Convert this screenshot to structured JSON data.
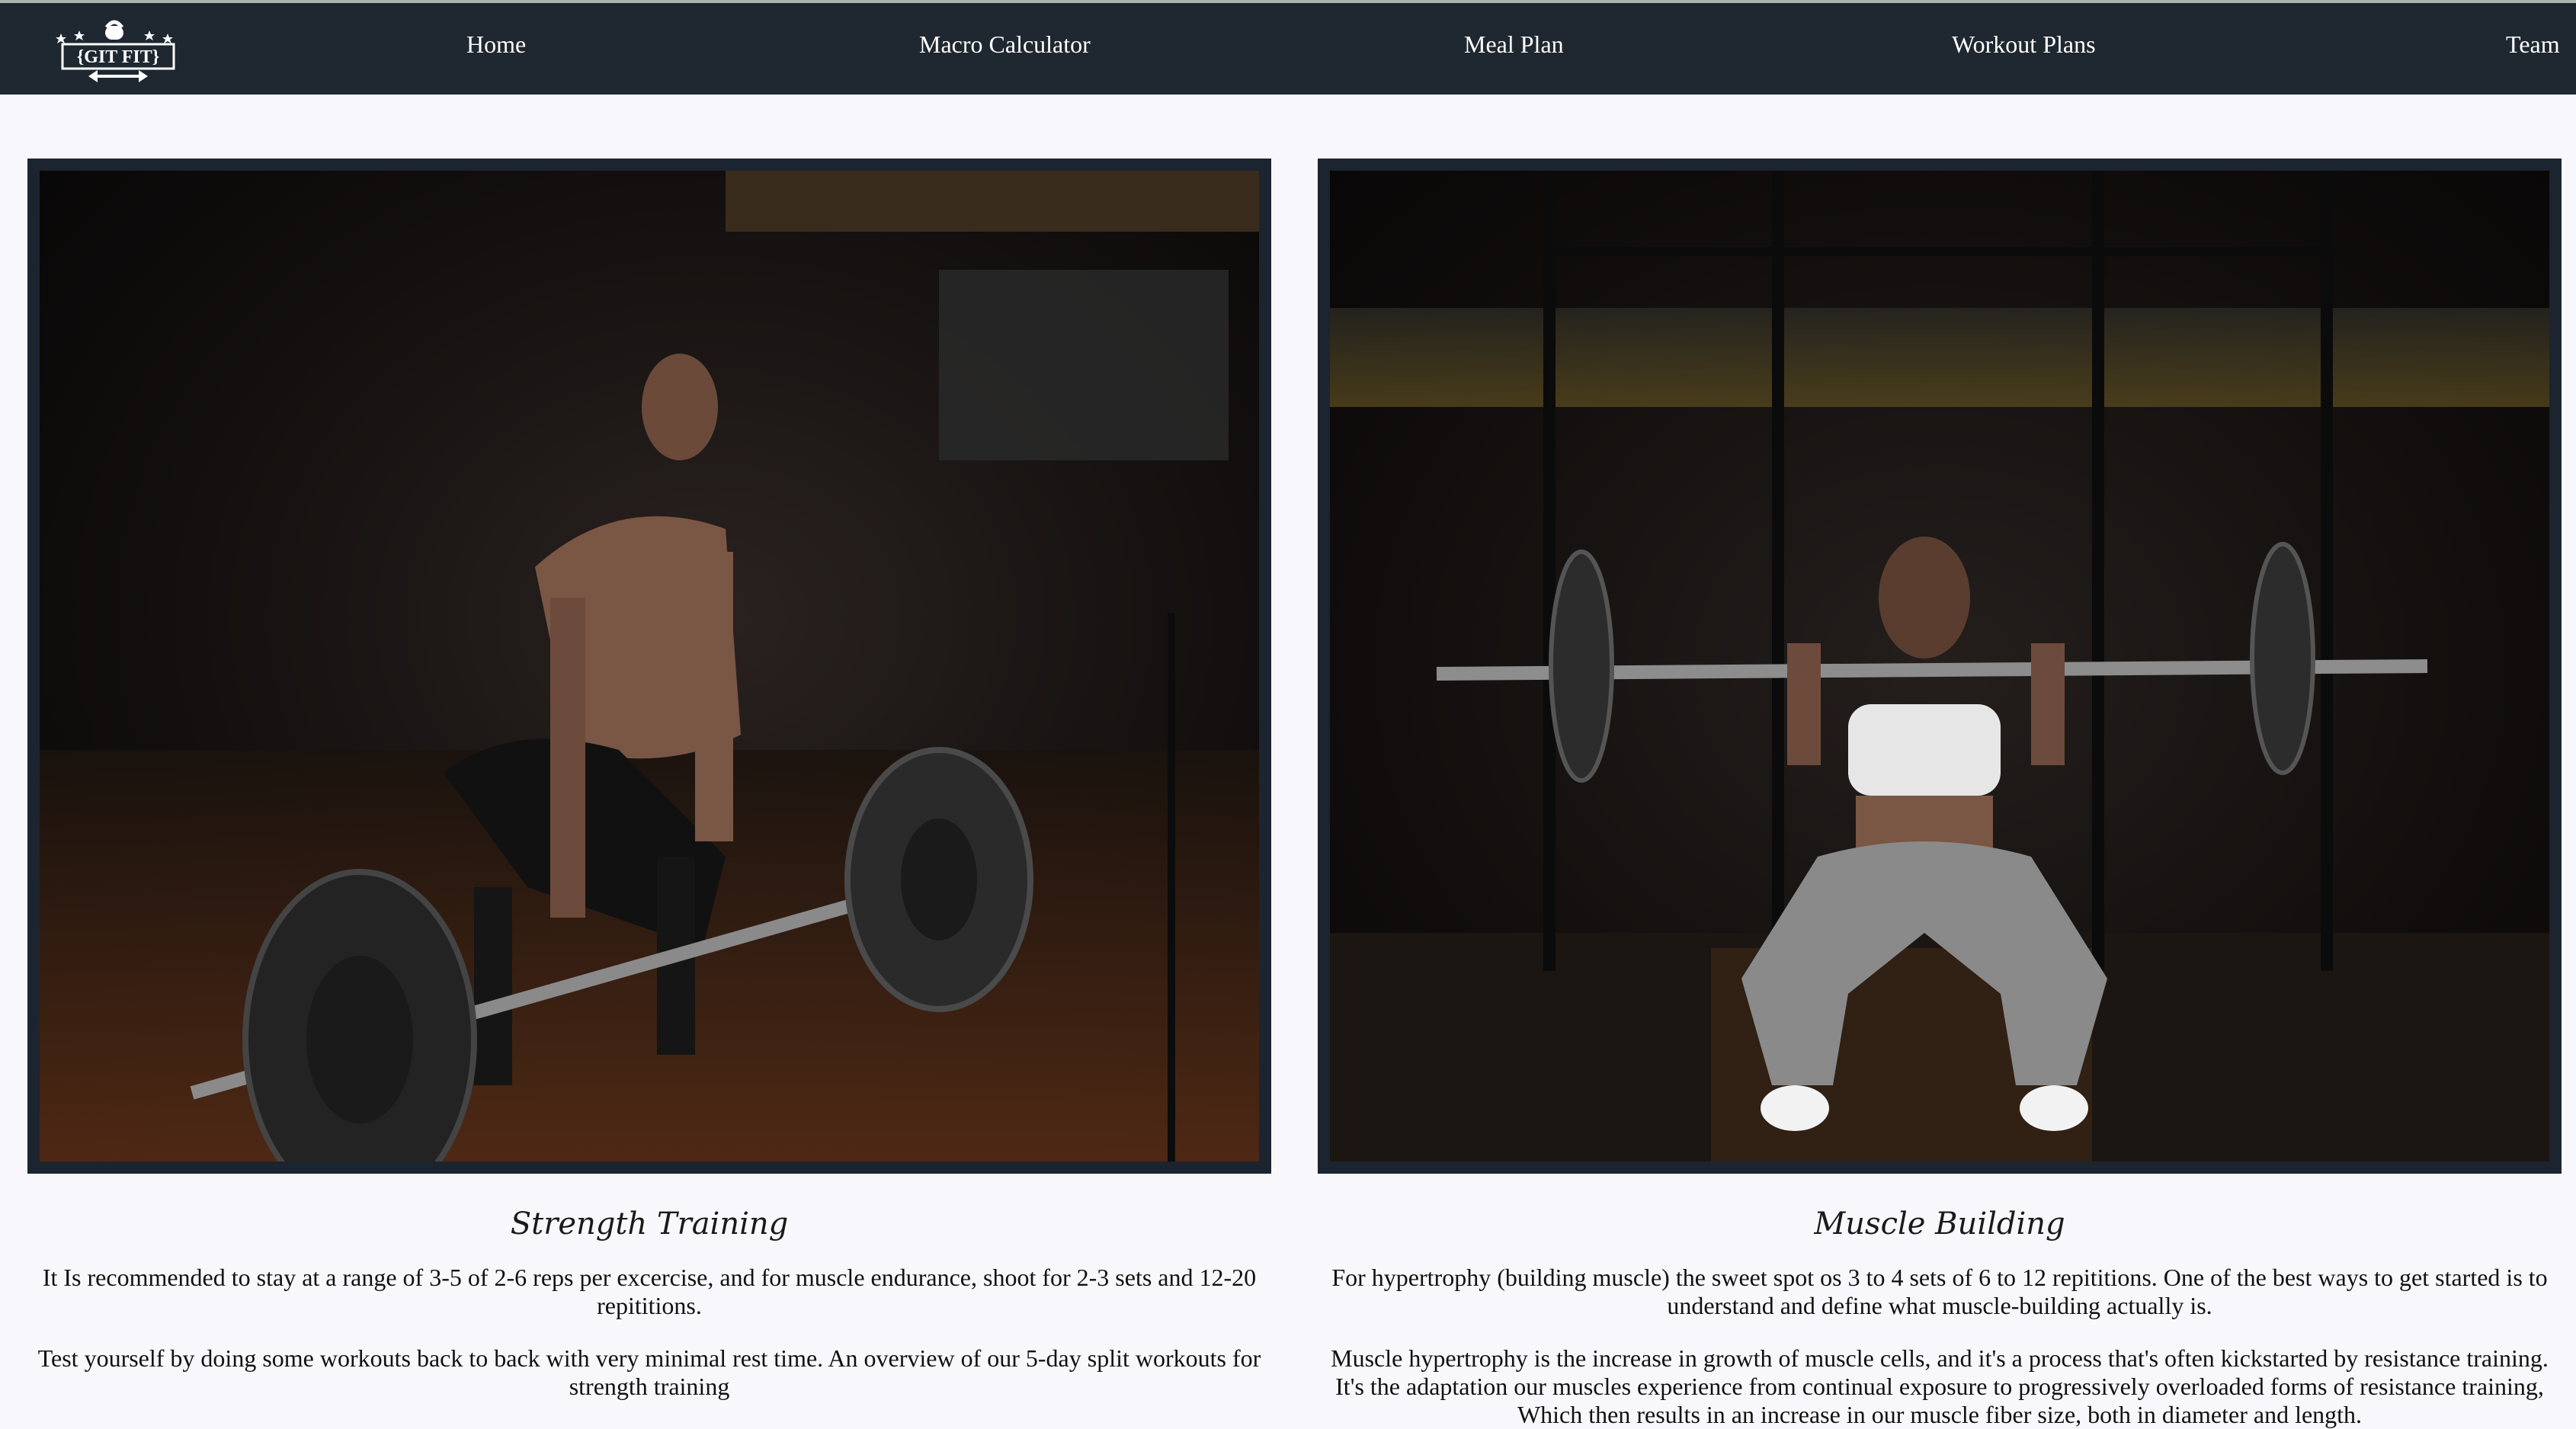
{
  "navbar": {
    "logo_text": "{GIT FIT}",
    "items": [
      {
        "label": "Home"
      },
      {
        "label": "Macro Calculator"
      },
      {
        "label": "Meal Plan"
      },
      {
        "label": "Workout Plans"
      },
      {
        "label": "Team"
      }
    ],
    "background": "#1f2731"
  },
  "cards": [
    {
      "image_alt": "Man performing a barbell deadlift in a dark gym",
      "title": "Strength Training",
      "paragraphs": [
        "It Is recommended to stay at a range of 3-5 of 2-6 reps per excercise, and for muscle endurance, shoot for 2-3 sets and 12-20 repititions.",
        "Test yourself by doing some workouts back to back with very minimal rest time. An overview of our 5-day split workouts for strength training"
      ]
    },
    {
      "image_alt": "Woman performing a front squat with a barbell in a dark gym",
      "title": "Muscle Building",
      "paragraphs": [
        "For hypertrophy (building muscle) the sweet spot os 3 to 4 sets of 6 to 12 repititions. One of the best ways to get started is to understand and define what muscle-building actually is.",
        "Muscle hypertrophy is the increase in growth of muscle cells, and it's a process that's often kickstarted by resistance training. It's the adaptation our muscles experience from continual exposure to progressively overloaded forms of resistance training, Which then results in an increase in our muscle fiber size, both in diameter and length."
      ]
    }
  ]
}
